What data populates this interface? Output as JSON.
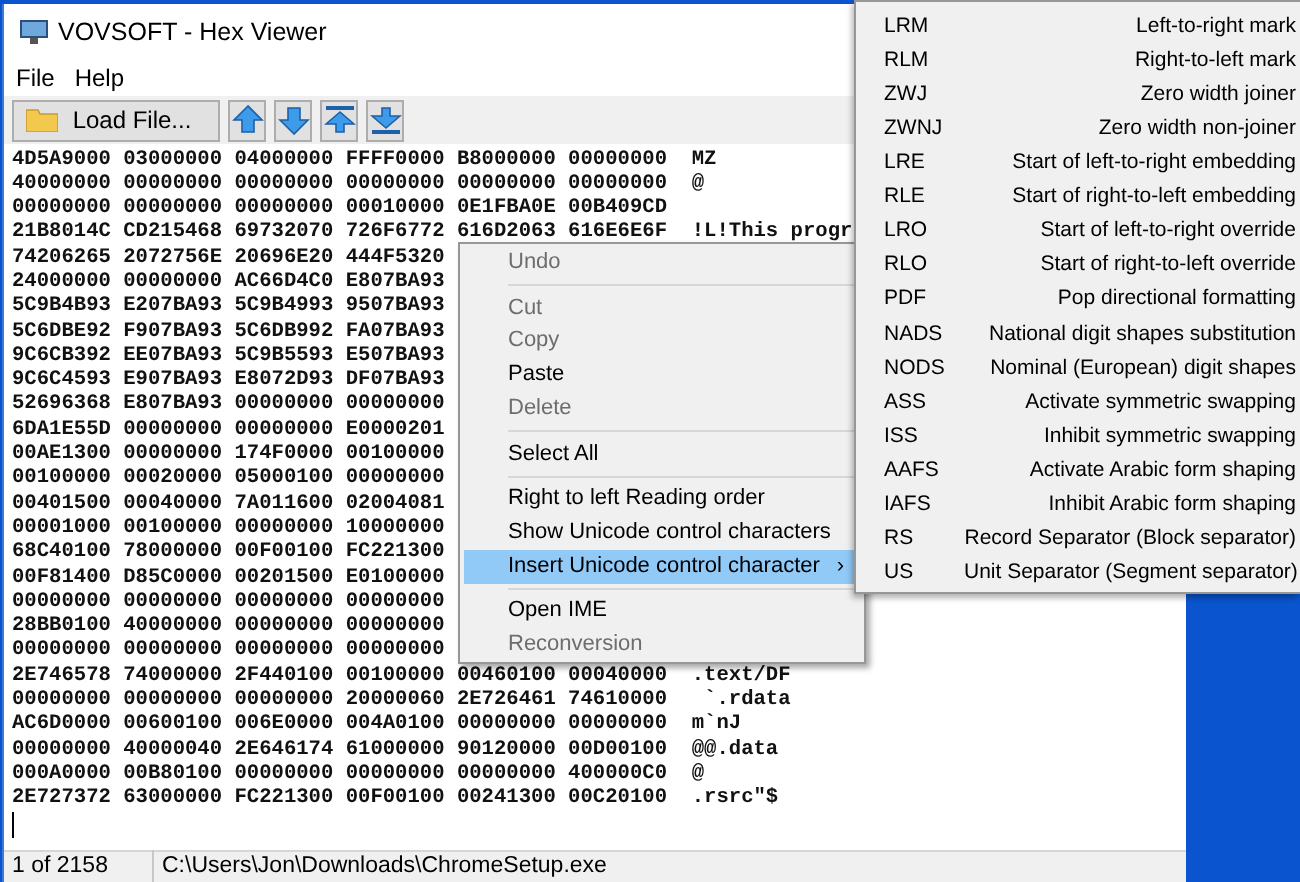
{
  "window": {
    "title": "VOVSOFT - Hex Viewer"
  },
  "menu_bar": [
    "File",
    "Help"
  ],
  "toolbar": {
    "load_button": "Load File...",
    "arrow_buttons": [
      {
        "kind": "up"
      },
      {
        "kind": "down"
      },
      {
        "kind": "top"
      },
      {
        "kind": "bottom"
      }
    ]
  },
  "hex_rows": [
    {
      "hex": "4D5A9000 03000000 04000000 FFFF0000 B8000000 00000000",
      "ascii": "MZ"
    },
    {
      "hex": "40000000 00000000 00000000 00000000 00000000 00000000",
      "ascii": "@"
    },
    {
      "hex": "00000000 00000000 00000000 00010000 0E1FBA0E 00B409CD"
    },
    {
      "hex": "21B8014C CD215468 69732070 726F6772 616D2063 616E6E6F",
      "ascii": "!L!This progr"
    },
    {
      "hex": "74206265 2072756E 20696E20 444F5320"
    },
    {
      "hex": "24000000 00000000 AC66D4C0 E807BA93"
    },
    {
      "hex": "5C9B4B93 E207BA93 5C9B4993 9507BA93"
    },
    {
      "hex": "5C6DBE92 F907BA93 5C6DB992 FA07BA93"
    },
    {
      "hex": "9C6CB392 EE07BA93 5C9B5593 E507BA93"
    },
    {
      "hex": "9C6C4593 E907BA93 E8072D93 DF07BA93"
    },
    {
      "hex": "52696368 E807BA93 00000000 00000000"
    },
    {
      "hex": "6DA1E55D 00000000 00000000 E0000201"
    },
    {
      "hex": "00AE1300 00000000 174F0000 00100000"
    },
    {
      "hex": "00100000 00020000 05000100 00000000"
    },
    {
      "hex": "00401500 00040000 7A011600 02004081"
    },
    {
      "hex": "00001000 00100000 00000000 10000000"
    },
    {
      "hex": "68C40100 78000000 00F00100 FC221300"
    },
    {
      "hex": "00F81400 D85C0000 00201500 E0100000"
    },
    {
      "hex": "00000000 00000000 00000000 00000000"
    },
    {
      "hex": "28BB0100 40000000 00000000 00000000"
    },
    {
      "hex": "00000000 00000000 00000000 00000000"
    },
    {
      "hex": "2E746578 74000000 2F440100 00100000 00460100 00040000",
      "ascii": ".text/DF"
    },
    {
      "hex": "00000000 00000000 00000000 20000060 2E726461 74610000",
      "ascii": " `.rdata"
    },
    {
      "hex": "AC6D0000 00600100 006E0000 004A0100 00000000 00000000",
      "ascii": "m`nJ"
    },
    {
      "hex": "00000000 40000040 2E646174 61000000 90120000 00D00100",
      "ascii": "@@.data"
    },
    {
      "hex": "000A0000 00B80100 00000000 00000000 00000000 400000C0",
      "ascii": "@"
    },
    {
      "hex": "2E727372 63000000 FC221300 00F00100 00241300 00C20100",
      "ascii": ".rsrc\"$"
    }
  ],
  "context_menu": [
    {
      "kind": "item",
      "label": "Undo",
      "disabled": true,
      "selected": false
    },
    {
      "kind": "separator"
    },
    {
      "kind": "item",
      "label": "Cut",
      "disabled": true,
      "selected": false
    },
    {
      "kind": "item",
      "label": "Copy",
      "disabled": true,
      "selected": false
    },
    {
      "kind": "item",
      "label": "Paste",
      "disabled": false,
      "selected": false
    },
    {
      "kind": "item",
      "label": "Delete",
      "disabled": true,
      "selected": false
    },
    {
      "kind": "separator"
    },
    {
      "kind": "item",
      "label": "Select All",
      "disabled": false,
      "selected": false
    },
    {
      "kind": "separator"
    },
    {
      "kind": "item",
      "label": "Right to left Reading order",
      "disabled": false,
      "selected": false
    },
    {
      "kind": "item",
      "label": "Show Unicode control characters",
      "disabled": false,
      "selected": false
    },
    {
      "kind": "item",
      "label": "Insert Unicode control character",
      "disabled": false,
      "selected": true,
      "arrow": "›"
    },
    {
      "kind": "separator"
    },
    {
      "kind": "item",
      "label": "Open IME",
      "disabled": false,
      "selected": false
    },
    {
      "kind": "item",
      "label": "Reconversion",
      "disabled": true,
      "selected": false
    }
  ],
  "submenu": [
    {
      "code": "LRM",
      "description": "Left-to-right mark"
    },
    {
      "code": "RLM",
      "description": "Right-to-left mark"
    },
    {
      "code": "ZWJ",
      "description": "Zero width joiner"
    },
    {
      "code": "ZWNJ",
      "description": "Zero width non-joiner"
    },
    {
      "code": "LRE",
      "description": "Start of left-to-right embedding"
    },
    {
      "code": "RLE",
      "description": "Start of right-to-left embedding"
    },
    {
      "code": "LRO",
      "description": "Start of left-to-right override"
    },
    {
      "code": "RLO",
      "description": "Start of right-to-left override"
    },
    {
      "code": "PDF",
      "description": "Pop directional formatting"
    },
    {
      "code": "NADS",
      "description": "National digit shapes substitution"
    },
    {
      "code": "NODS",
      "description": "Nominal (European) digit shapes"
    },
    {
      "code": "ASS",
      "description": "Activate symmetric swapping"
    },
    {
      "code": "ISS",
      "description": "Inhibit symmetric swapping"
    },
    {
      "code": "AAFS",
      "description": "Activate Arabic form shaping"
    },
    {
      "code": "IAFS",
      "description": "Inhibit Arabic form shaping"
    },
    {
      "code": "RS",
      "description": "Record Separator (Block separator)"
    },
    {
      "code": "US",
      "description": "Unit Separator (Segment separator)"
    }
  ],
  "status_bar": {
    "position": "1 of 2158",
    "path": "C:\\Users\\Jon\\Downloads\\ChromeSetup.exe"
  }
}
